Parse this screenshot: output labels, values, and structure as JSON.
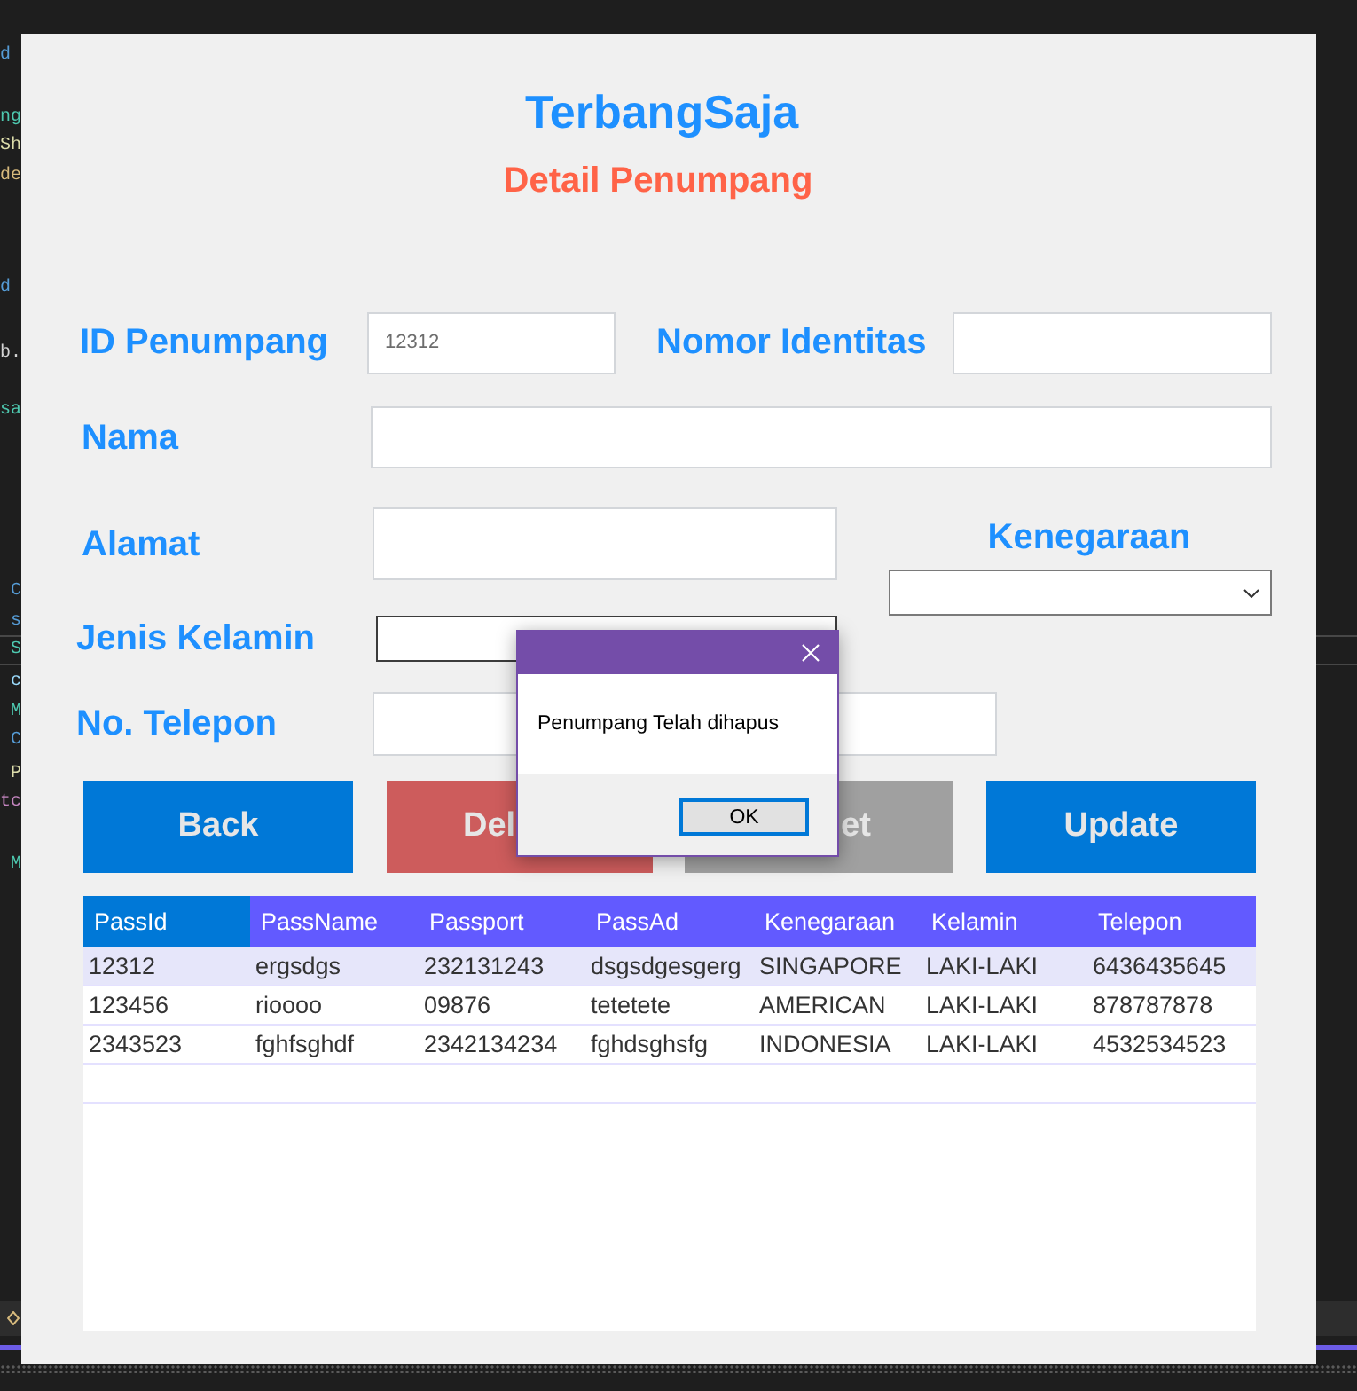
{
  "background_editor": {
    "code_lines": [
      {
        "text": "d",
        "color": "#569cd6"
      },
      {
        "text": "ng",
        "color": "#4ec9b0"
      },
      {
        "text": "Sh",
        "color": "#dcdcaa"
      },
      {
        "text": "de",
        "color": "#d7ba7d"
      },
      {
        "text": "d",
        "color": "#569cd6"
      },
      {
        "text": "b.",
        "color": "#d4d4d4"
      },
      {
        "text": "sa",
        "color": "#4ec9b0"
      },
      {
        "text": "C",
        "color": "#569cd6"
      },
      {
        "text": "s",
        "color": "#569cd6"
      },
      {
        "text": "S",
        "color": "#4ec9b0"
      },
      {
        "text": "c",
        "color": "#9cdcfe"
      },
      {
        "text": "M",
        "color": "#4ec9b0"
      },
      {
        "text": "C",
        "color": "#569cd6"
      },
      {
        "text": "P",
        "color": "#dcdcaa"
      },
      {
        "text": "tc",
        "color": "#c586c0"
      },
      {
        "text": "M",
        "color": "#4ec9b0"
      }
    ]
  },
  "window": {
    "title": "TerbangSaja",
    "subtitle": "Detail Penumpang"
  },
  "form": {
    "fields": [
      {
        "label": "ID Penumpang",
        "kind": "textbox",
        "value": "12312"
      },
      {
        "label": "Nomor Identitas",
        "kind": "textbox"
      },
      {
        "label": "Nama",
        "kind": "textbox"
      },
      {
        "label": "Alamat",
        "kind": "textbox"
      },
      {
        "label": "Kenegaraan",
        "kind": "combobox"
      },
      {
        "label": "Jenis Kelamin",
        "kind": "framed"
      },
      {
        "label": "No. Telepon",
        "kind": "textbox"
      }
    ]
  },
  "buttons": [
    {
      "label": "Back",
      "kind": "primary"
    },
    {
      "label": "Del",
      "kind": "danger"
    },
    {
      "label": "et",
      "kind": "neutral"
    },
    {
      "label": "Update",
      "kind": "primary"
    }
  ],
  "table": {
    "columns": [
      {
        "label": "PassId",
        "selected": true
      },
      {
        "label": "PassName",
        "selected": false
      },
      {
        "label": "Passport",
        "selected": false
      },
      {
        "label": "PassAd",
        "selected": false
      },
      {
        "label": "Kenegaraan",
        "selected": false
      },
      {
        "label": "Kelamin",
        "selected": false
      },
      {
        "label": "Telepon",
        "selected": false
      }
    ],
    "rows": [
      {
        "selected": true,
        "cells": [
          "12312",
          "ergsdgs",
          "232131243",
          "dsgsdgesgerg",
          "SINGAPORE",
          "LAKI-LAKI",
          "6436435645"
        ]
      },
      {
        "selected": false,
        "cells": [
          "123456",
          "rioooo",
          "09876",
          "tetetete",
          "AMERICAN",
          "LAKI-LAKI",
          "878787878"
        ]
      },
      {
        "selected": false,
        "cells": [
          "2343523",
          "fghfsghdf",
          "2342134234",
          "fghdsghsfg",
          "INDONESIA",
          "LAKI-LAKI",
          "4532534523"
        ]
      }
    ]
  },
  "dialog": {
    "message": "Penumpang Telah dihapus",
    "buttons": [
      {
        "label": "OK",
        "focused": true
      }
    ]
  }
}
